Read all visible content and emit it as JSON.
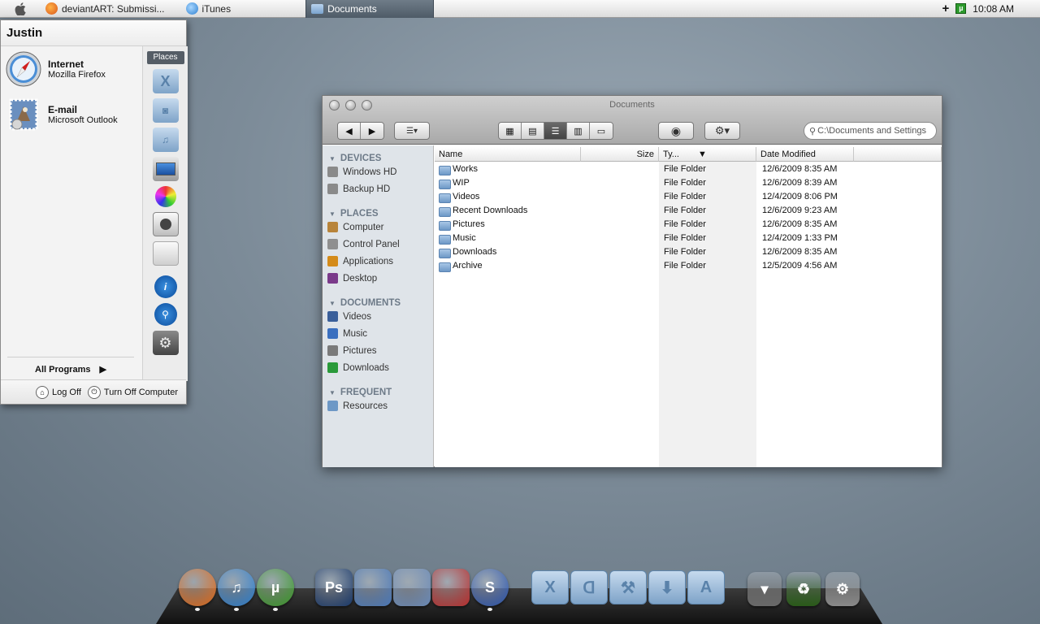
{
  "menubar": {
    "tasks": [
      {
        "label": "deviantART: Submissi...",
        "icon": "firefox-icon"
      },
      {
        "label": "iTunes",
        "icon": "itunes-icon"
      },
      {
        "label": "Documents",
        "icon": "folder-icon"
      }
    ],
    "tray_plus": "+",
    "utorrent_badge": "µ",
    "clock": "10:08 AM"
  },
  "start_menu": {
    "user": "Justin",
    "pinned": [
      {
        "title": "Internet",
        "subtitle": "Mozilla Firefox",
        "icon": "safari-compass-icon"
      },
      {
        "title": "E-mail",
        "subtitle": "Microsoft Outlook",
        "icon": "mail-stamp-icon"
      }
    ],
    "all_programs": "All Programs",
    "places_label": "Places",
    "right_icons": [
      "x-folder-icon",
      "pictures-folder-icon",
      "music-folder-icon",
      "monitor-icon",
      "color-tools-icon",
      "speaker-icon",
      "printer-icon",
      "info-icon",
      "search-icon",
      "settings-icon"
    ],
    "log_off": "Log Off",
    "turn_off": "Turn Off Computer"
  },
  "finder": {
    "title": "Documents",
    "search_placeholder": "C:\\Documents and Settings",
    "sidebar": [
      {
        "header": "DEVICES",
        "items": [
          {
            "label": "Windows HD",
            "color": "#8a8a8a"
          },
          {
            "label": "Backup HD",
            "color": "#8a8a8a"
          }
        ]
      },
      {
        "header": "PLACES",
        "items": [
          {
            "label": "Computer",
            "color": "#b8843a"
          },
          {
            "label": "Control Panel",
            "color": "#8f8f8f"
          },
          {
            "label": "Applications",
            "color": "#d48b1a"
          },
          {
            "label": "Desktop",
            "color": "#7a3a8a"
          }
        ]
      },
      {
        "header": "DOCUMENTS",
        "items": [
          {
            "label": "Videos",
            "color": "#3a5f9a"
          },
          {
            "label": "Music",
            "color": "#3a6fbf"
          },
          {
            "label": "Pictures",
            "color": "#7a7a7a"
          },
          {
            "label": "Downloads",
            "color": "#2a9a3a"
          }
        ]
      },
      {
        "header": "FREQUENT",
        "items": [
          {
            "label": "Resources",
            "color": "#6d98c6"
          }
        ]
      }
    ],
    "columns": {
      "name": "Name",
      "size": "Size",
      "type": "Ty...",
      "date": "Date Modified"
    },
    "rows": [
      {
        "name": "Works",
        "type": "File Folder",
        "date": "12/6/2009 8:35 AM"
      },
      {
        "name": "WIP",
        "type": "File Folder",
        "date": "12/6/2009 8:39 AM"
      },
      {
        "name": "Videos",
        "type": "File Folder",
        "date": "12/4/2009 8:06 PM"
      },
      {
        "name": "Recent Downloads",
        "type": "File Folder",
        "date": "12/6/2009 9:23 AM"
      },
      {
        "name": "Pictures",
        "type": "File Folder",
        "date": "12/6/2009 8:35 AM"
      },
      {
        "name": "Music",
        "type": "File Folder",
        "date": "12/4/2009 1:33 PM"
      },
      {
        "name": "Downloads",
        "type": "File Folder",
        "date": "12/6/2009 8:35 AM"
      },
      {
        "name": "Archive",
        "type": "File Folder",
        "date": "12/5/2009 4:56 AM"
      }
    ]
  },
  "dock": {
    "apps": [
      {
        "name": "firefox-icon",
        "label": "",
        "color": "#e06a1a",
        "running": true
      },
      {
        "name": "itunes-icon",
        "label": "♫",
        "color": "#2c7fd0",
        "running": true
      },
      {
        "name": "utorrent-icon",
        "label": "µ",
        "color": "#3a9a2a",
        "running": true
      },
      {
        "name": "photoshop-icon",
        "label": "Ps",
        "color": "#1b3a6b",
        "running": false
      },
      {
        "name": "paint-brush-icon",
        "label": "",
        "color": "#4a78b8",
        "running": false
      },
      {
        "name": "presentation-icon",
        "label": "",
        "color": "#6a8ab8",
        "running": false
      },
      {
        "name": "book-icon",
        "label": "",
        "color": "#b83030",
        "running": false
      },
      {
        "name": "s-app-icon",
        "label": "S",
        "color": "#2a55b0",
        "running": true
      }
    ],
    "folders": [
      {
        "name": "x-folder-icon",
        "label": "X"
      },
      {
        "name": "deviantart-folder-icon",
        "label": "ᗡ"
      },
      {
        "name": "tools-folder-icon",
        "label": "⚒"
      },
      {
        "name": "downloads-folder-icon",
        "label": "⬇"
      },
      {
        "name": "applications-folder-icon",
        "label": "A"
      }
    ],
    "system": [
      {
        "name": "eject-icon",
        "label": "▾",
        "color": "#6a6a6a"
      },
      {
        "name": "recycle-bin-icon",
        "label": "♻",
        "color": "#2a5a1a"
      },
      {
        "name": "system-preferences-icon",
        "label": "⚙",
        "color": "#8a8a8a"
      }
    ]
  }
}
